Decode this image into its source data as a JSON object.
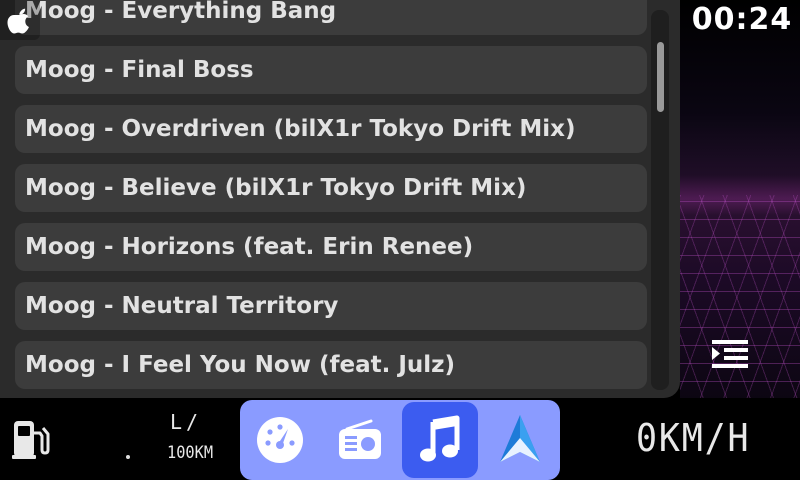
{
  "clock": "00:24",
  "songs": [
    "Moog - Everything Bang",
    "Moog - Final Boss",
    "Moog - Overdriven (bilX1r Tokyo Drift Mix)",
    "Moog - Believe (bilX1r Tokyo Drift Mix)",
    "Moog - Horizons (feat. Erin Renee)",
    "Moog - Neutral Territory",
    "Moog - I Feel You Now (feat. Julz)"
  ],
  "consumption": {
    "value": ".",
    "unit_top": "L/",
    "unit_bottom": "100KM"
  },
  "speed": "0KM/H",
  "dock": {
    "apps": [
      {
        "name": "dashboard",
        "icon": "speedometer-icon",
        "active": false
      },
      {
        "name": "radio",
        "icon": "radio-icon",
        "active": false
      },
      {
        "name": "music",
        "icon": "music-note-icon",
        "active": true
      },
      {
        "name": "navigation",
        "icon": "navigation-arrow-icon",
        "active": false
      }
    ]
  },
  "colors": {
    "dock": "#8a9bff",
    "dock_active": "#3c5cf0",
    "panel": "#2b2b2b",
    "list_item": "#3c3c3c"
  }
}
